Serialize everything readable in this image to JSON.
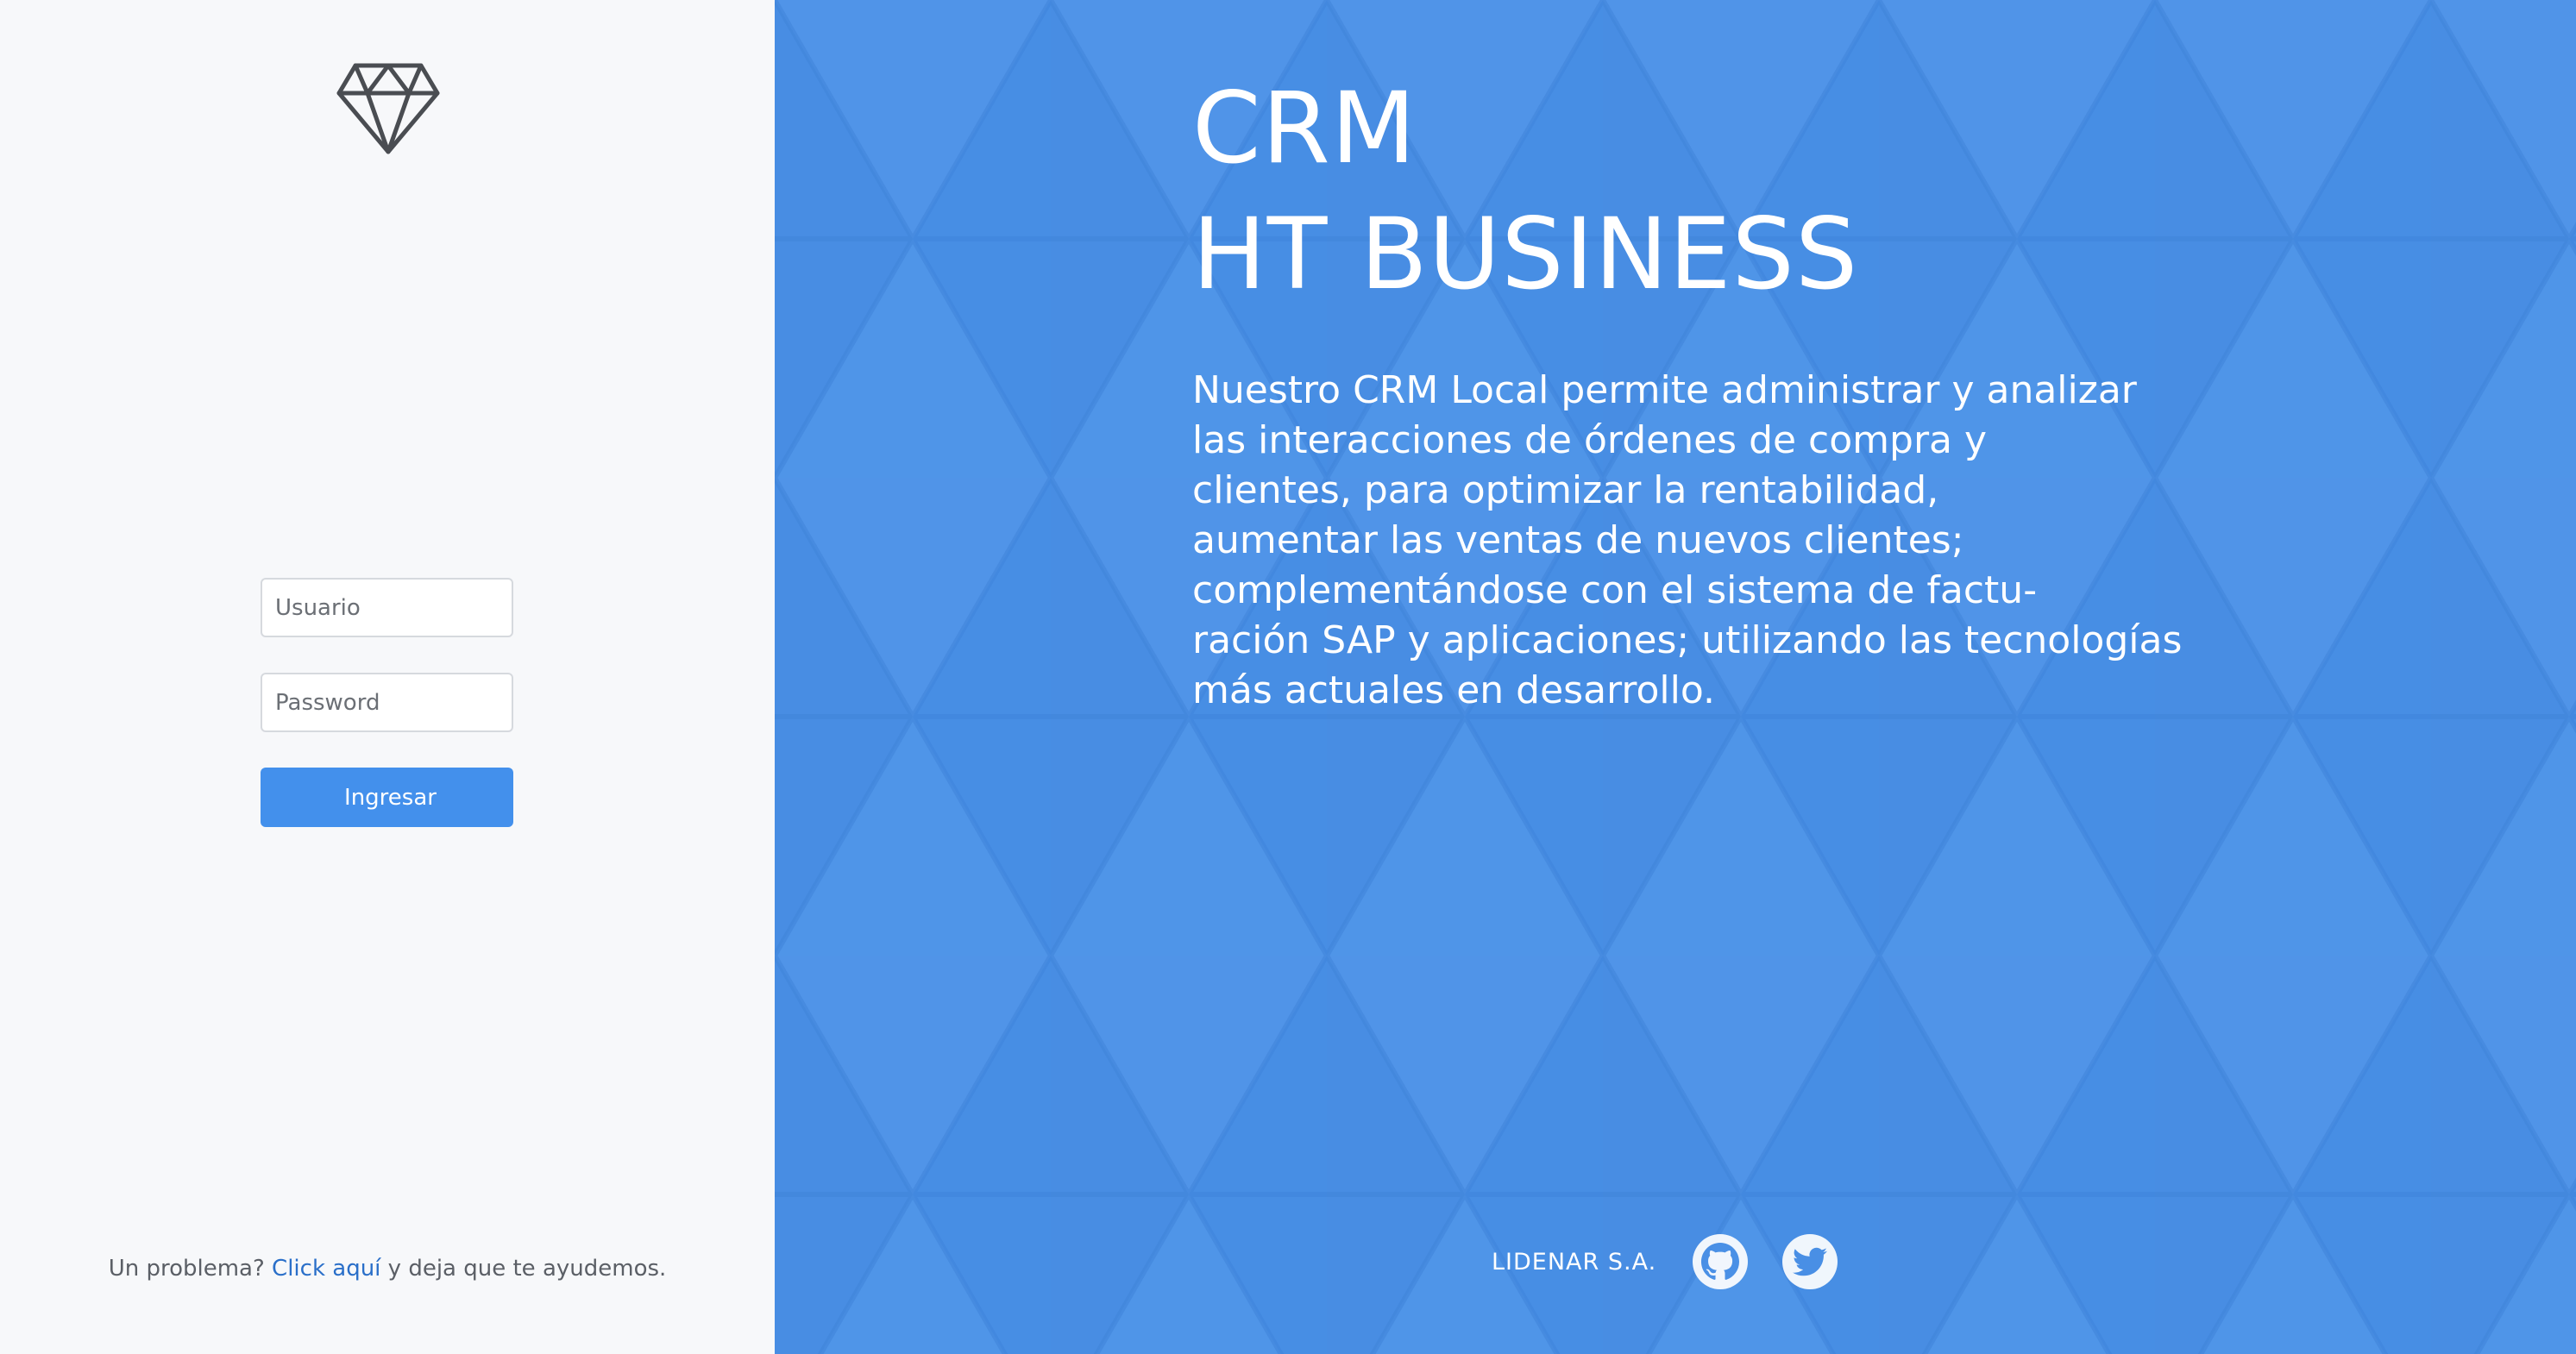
{
  "login": {
    "username_placeholder": "Usuario",
    "password_placeholder": "Password",
    "submit_label": "Ingresar",
    "help_prefix": "Un problema?",
    "help_link": "Click aquí",
    "help_suffix": "y deja que te ayudemos."
  },
  "hero": {
    "title_line1": "CRM",
    "title_line2": "HT BUSINESS",
    "description_lines": [
      "Nuestro CRM Local permite administrar y analizar",
      "las interacciones de órdenes de compra y",
      "clientes, para optimizar la rentabilidad,",
      "aumentar las ventas de nuevos clientes;",
      "complementándose con el sistema de factu-",
      "ración SAP y aplicaciones; utilizando las tecnologías",
      "más actuales en desarrollo."
    ]
  },
  "footer": {
    "company": "LIDENAR S.A.",
    "social_icons": [
      "github-icon",
      "twitter-icon"
    ]
  },
  "colors": {
    "accent": "#4390ec",
    "hero_background": "#4a90e6",
    "left_background": "#f7f8fa",
    "link": "#2a6fc9"
  },
  "icons": {
    "logo": "diamond-icon"
  }
}
